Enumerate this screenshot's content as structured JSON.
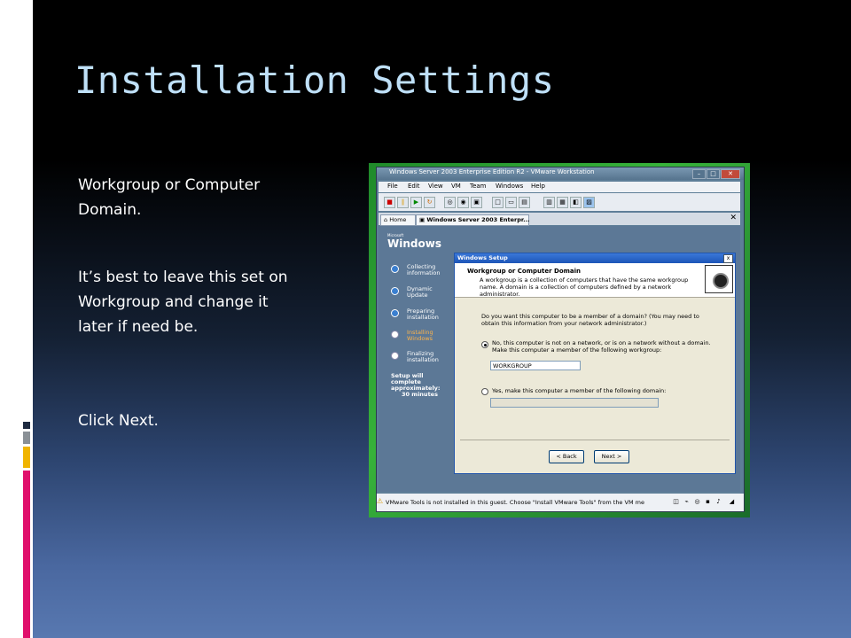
{
  "slide": {
    "title": "Installation Settings",
    "paragraph1": "Workgroup or Computer Domain.",
    "paragraph2": "It’s best to leave this set on Workgroup and change it later if need be.",
    "paragraph3": "Click Next."
  },
  "colors": {
    "title": "#bfe0f8",
    "deco_dark": "#1e2a40",
    "deco_gray": "#8a9096",
    "deco_yellow": "#f0b400",
    "deco_magenta": "#e0106c"
  },
  "screenshot": {
    "window_title": "Windows Server 2003 Enterprise Edition R2 - VMware Workstation",
    "menu": [
      "File",
      "Edit",
      "View",
      "VM",
      "Team",
      "Windows",
      "Help"
    ],
    "tabs": {
      "home": "Home",
      "vm": "Windows Server 2003 Enterpr..."
    },
    "windows_logo": "Windows",
    "windows_logo_small": "Microsoft",
    "steps": [
      {
        "label": "Collecting information",
        "state": "done"
      },
      {
        "label": "Dynamic Update",
        "state": "done"
      },
      {
        "label": "Preparing installation",
        "state": "done"
      },
      {
        "label": "Installing Windows",
        "state": "active"
      },
      {
        "label": "Finalizing installation",
        "state": "pending"
      }
    ],
    "setup_complete_label": "Setup will complete approximately:",
    "setup_complete_time": "30 minutes",
    "dialog": {
      "title": "Windows Setup",
      "close_glyph": "x",
      "heading": "Workgroup or Computer Domain",
      "description": "A workgroup is a collection of computers that have the same workgroup name. A domain is a collection of computers defined by a network administrator.",
      "question": "Do you want this computer to be a member of a domain? (You may need to obtain this information from your network administrator.)",
      "option_workgroup": "No, this computer is not on a network, or is on a network without a domain. Make this computer a member of the following workgroup:",
      "workgroup_value": "WORKGROUP",
      "option_domain": "Yes, make this computer a member of the following domain:",
      "domain_value": "",
      "back_label": "< Back",
      "next_label": "Next >"
    },
    "status_text": "VMware Tools is not installed in this guest. Choose \"Install VMware Tools\" from the VM me"
  }
}
